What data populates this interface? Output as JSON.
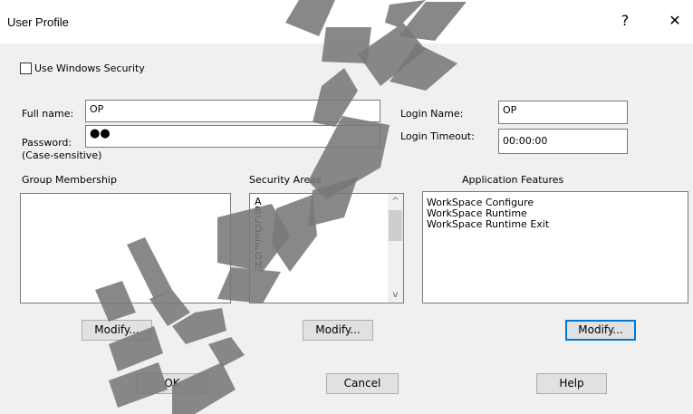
{
  "window": {
    "title": "User Profile",
    "help_glyph": "?",
    "close_glyph": "✕"
  },
  "security": {
    "use_windows_label": "Use Windows Security",
    "checked": false
  },
  "fields": {
    "full_name_label": "Full name:",
    "full_name_value": "OP",
    "password_label": "Password:",
    "password_value": "●●",
    "password_note": "(Case-sensitive)",
    "login_name_label": "Login Name:",
    "login_name_value": "OP",
    "login_timeout_label": "Login Timeout:",
    "login_timeout_value": "00:00:00"
  },
  "groups": {
    "label": "Group Membership",
    "items": []
  },
  "security_areas": {
    "label": "Security Areas",
    "items": [
      "A",
      "B",
      "C",
      "D",
      "E",
      "F",
      "G",
      "H"
    ],
    "scroll_up_glyph": "^",
    "scroll_down_glyph": "v"
  },
  "features": {
    "label": "Application Features",
    "items": [
      "WorkSpace Configure",
      "WorkSpace Runtime",
      "WorkSpace Runtime Exit"
    ]
  },
  "buttons": {
    "modify_groups": "Modify...",
    "modify_security": "Modify...",
    "modify_features": "Modify...",
    "ok": "OK",
    "cancel": "Cancel",
    "help": "Help"
  }
}
